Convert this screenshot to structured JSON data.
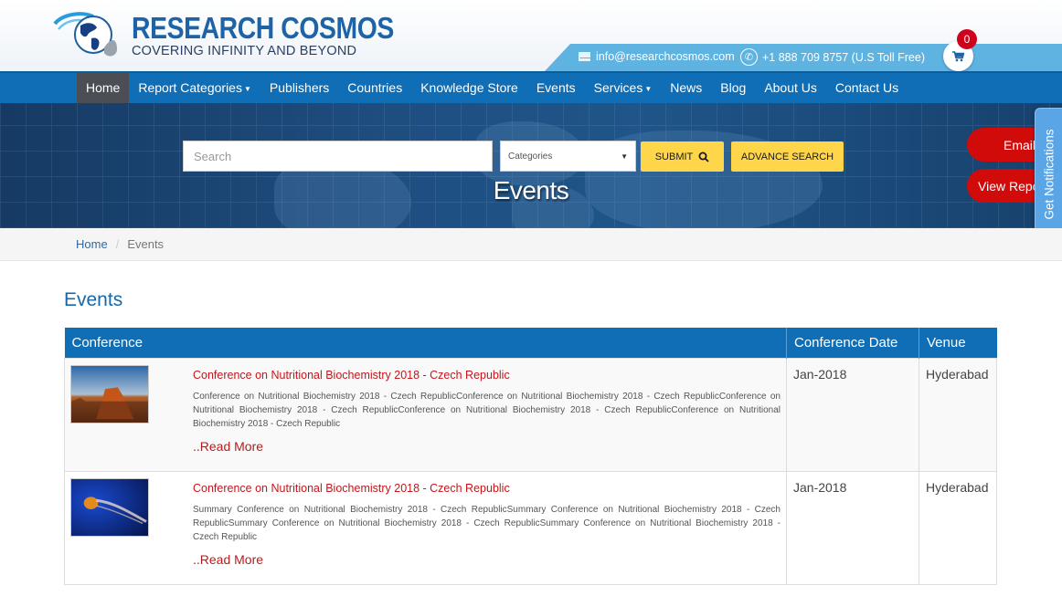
{
  "brand": {
    "title": "RESEARCH COSMOS",
    "tagline": "COVERING INFINITY AND BEYOND"
  },
  "contact": {
    "email": "info@researchcosmos.com",
    "phone": "+1 888 709 8757 (U.S Toll Free)",
    "email_icon": "envelope-icon",
    "phone_icon": "phone-icon"
  },
  "cart": {
    "count": "0",
    "icon": "shopping-cart-icon"
  },
  "nav": {
    "items": [
      {
        "label": "Home",
        "active": true,
        "dropdown": false
      },
      {
        "label": "Report Categories",
        "active": false,
        "dropdown": true
      },
      {
        "label": "Publishers",
        "active": false,
        "dropdown": false
      },
      {
        "label": "Countries",
        "active": false,
        "dropdown": false
      },
      {
        "label": "Knowledge Store",
        "active": false,
        "dropdown": false
      },
      {
        "label": "Events",
        "active": false,
        "dropdown": false
      },
      {
        "label": "Services",
        "active": false,
        "dropdown": true
      },
      {
        "label": "News",
        "active": false,
        "dropdown": false
      },
      {
        "label": "Blog",
        "active": false,
        "dropdown": false
      },
      {
        "label": "About Us",
        "active": false,
        "dropdown": false
      },
      {
        "label": "Contact Us",
        "active": false,
        "dropdown": false
      }
    ]
  },
  "search": {
    "placeholder": "Search",
    "value": "",
    "category_selected": "Categories",
    "submit_label": "SUBMIT",
    "advance_label": "ADVANCE SEARCH"
  },
  "banner": {
    "title": "Events"
  },
  "side_buttons": {
    "email": "Email",
    "view_report": "View Repo",
    "notifications": "Get Notifications"
  },
  "breadcrumb": {
    "home": "Home",
    "separator": "/",
    "current": "Events"
  },
  "page": {
    "heading": "Events"
  },
  "table": {
    "columns": [
      "Conference",
      "Conference Date",
      "Venue"
    ],
    "rows": [
      {
        "image": "desert-butte-photo",
        "title": "Conference on Nutritional Biochemistry 2018 - Czech Republic",
        "description": "Conference on Nutritional Biochemistry 2018 - Czech RepublicConference on Nutritional Biochemistry 2018 - Czech RepublicConference on Nutritional Biochemistry 2018 - Czech RepublicConference on Nutritional Biochemistry 2018 - Czech RepublicConference on Nutritional Biochemistry 2018 - Czech Republic",
        "read_more": "..Read More",
        "date": "Jan-2018",
        "venue": "Hyderabad"
      },
      {
        "image": "jellyfish-photo",
        "title": "Conference on Nutritional Biochemistry 2018 - Czech Republic",
        "description": "Summary Conference on Nutritional Biochemistry 2018 - Czech RepublicSummary Conference on Nutritional Biochemistry 2018 - Czech RepublicSummary Conference on Nutritional Biochemistry 2018 - Czech RepublicSummary Conference on Nutritional Biochemistry 2018 - Czech Republic",
        "read_more": "..Read More",
        "date": "Jan-2018",
        "venue": "Hyderabad"
      }
    ]
  },
  "colors": {
    "brand_blue": "#1d63a5",
    "nav_blue": "#0f6eb5",
    "contact_bar": "#5fb3e0",
    "accent_yellow": "#ffd54a",
    "accent_red": "#d10a0a",
    "link_red": "#c4161c"
  }
}
